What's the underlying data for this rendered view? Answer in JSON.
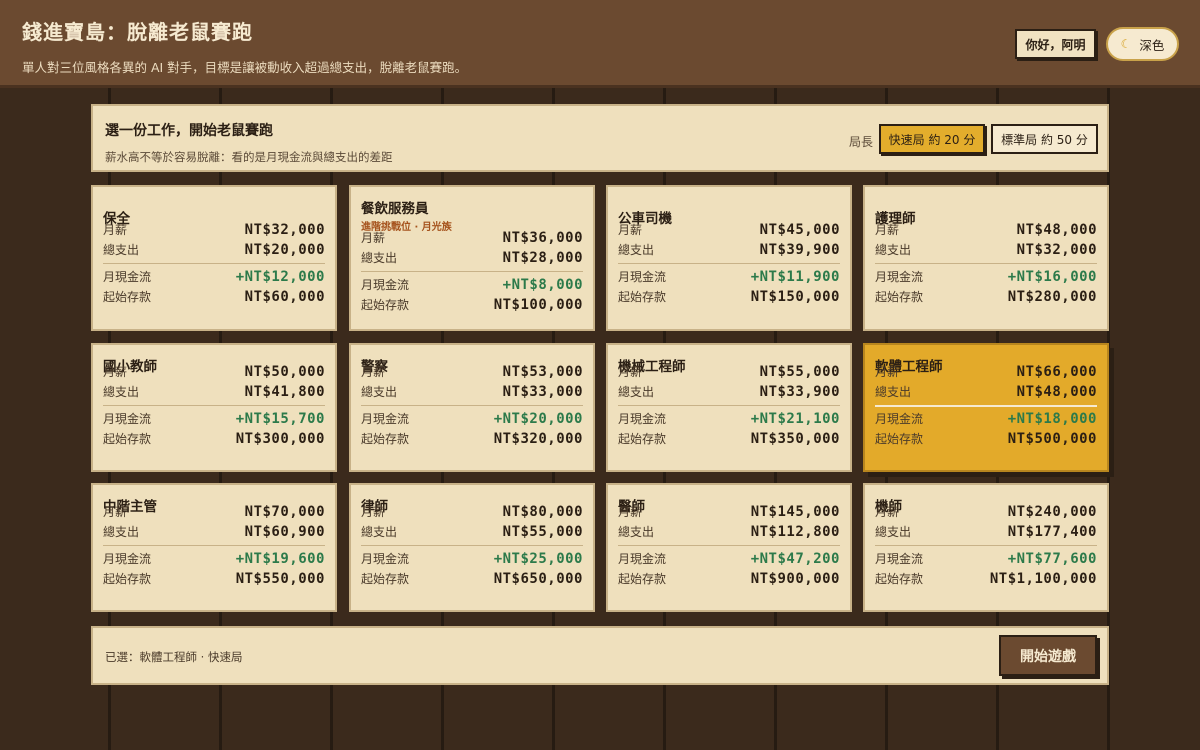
{
  "header": {
    "title": "錢進寶島：脫離老鼠賽跑",
    "subtitle": "單人對三位風格各異的 AI 對手，目標是讓被動收入超過總支出，脫離老鼠賽跑。",
    "greeting_label": "你好，阿明",
    "theme_label": "深色",
    "theme_icon": "moon-icon"
  },
  "picker": {
    "title": "選一份工作，開始老鼠賽跑",
    "subtitle": "薪水高不等於容易脫離：看的是月現金流與總支出的差距",
    "round_label": "局長",
    "modes": [
      {
        "label": "快速局 約 20 分",
        "selected": true
      },
      {
        "label": "標準局 約 50 分",
        "selected": false
      }
    ]
  },
  "labels": {
    "salary": "月薪",
    "expense": "總支出",
    "cashflow": "月現金流",
    "savings": "起始存款"
  },
  "jobs": [
    {
      "name": "保全",
      "tag": "",
      "salary": "NT$32,000",
      "expense": "NT$20,000",
      "cashflow": "+NT$12,000",
      "savings": "NT$60,000",
      "selected": false
    },
    {
      "name": "餐飲服務員",
      "tag": "進階挑戰位 · 月光族",
      "salary": "NT$36,000",
      "expense": "NT$28,000",
      "cashflow": "+NT$8,000",
      "savings": "NT$100,000",
      "selected": false
    },
    {
      "name": "公車司機",
      "tag": "",
      "salary": "NT$45,000",
      "expense": "NT$39,900",
      "cashflow": "+NT$11,900",
      "savings": "NT$150,000",
      "selected": false
    },
    {
      "name": "護理師",
      "tag": "",
      "salary": "NT$48,000",
      "expense": "NT$32,000",
      "cashflow": "+NT$16,000",
      "savings": "NT$280,000",
      "selected": false
    },
    {
      "name": "國小教師",
      "tag": "",
      "salary": "NT$50,000",
      "expense": "NT$41,800",
      "cashflow": "+NT$15,700",
      "savings": "NT$300,000",
      "selected": false
    },
    {
      "name": "警察",
      "tag": "",
      "salary": "NT$53,000",
      "expense": "NT$33,000",
      "cashflow": "+NT$20,000",
      "savings": "NT$320,000",
      "selected": false
    },
    {
      "name": "機械工程師",
      "tag": "",
      "salary": "NT$55,000",
      "expense": "NT$33,900",
      "cashflow": "+NT$21,100",
      "savings": "NT$350,000",
      "selected": false
    },
    {
      "name": "軟體工程師",
      "tag": "",
      "salary": "NT$66,000",
      "expense": "NT$48,000",
      "cashflow": "+NT$18,000",
      "savings": "NT$500,000",
      "selected": true
    },
    {
      "name": "中階主管",
      "tag": "",
      "salary": "NT$70,000",
      "expense": "NT$60,900",
      "cashflow": "+NT$19,600",
      "savings": "NT$550,000",
      "selected": false
    },
    {
      "name": "律師",
      "tag": "",
      "salary": "NT$80,000",
      "expense": "NT$55,000",
      "cashflow": "+NT$25,000",
      "savings": "NT$650,000",
      "selected": false
    },
    {
      "name": "醫師",
      "tag": "",
      "salary": "NT$145,000",
      "expense": "NT$112,800",
      "cashflow": "+NT$47,200",
      "savings": "NT$900,000",
      "selected": false
    },
    {
      "name": "機師",
      "tag": "",
      "salary": "NT$240,000",
      "expense": "NT$177,400",
      "cashflow": "+NT$77,600",
      "savings": "NT$1,100,000",
      "selected": false
    }
  ],
  "footer": {
    "selection_text": "已選：軟體工程師 · 快速局",
    "start_label": "開始遊戲"
  }
}
